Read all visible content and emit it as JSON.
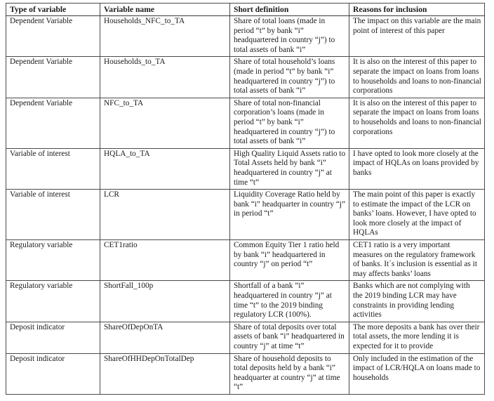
{
  "table": {
    "headers": [
      "Type of variable",
      "Variable  name",
      "Short definition",
      "Reasons for inclusion"
    ],
    "rows": [
      {
        "type": "Dependent Variable",
        "name": "Households_NFC_to_TA",
        "definition": "Share of total loans (made in period “t” by bank “i” headquartered in country “j”) to total assets of bank “i”",
        "reason": "The impact on this variable are the main point of interest of this paper"
      },
      {
        "type": "Dependent Variable",
        "name": "Households_to_TA",
        "definition": "Share of total household’s loans (made in period “t” by bank “i” headquartered in country “j”) to total assets of bank “i”",
        "reason": "It is also on the interest of this paper to separate the impact on loans from loans to households and loans to non-financial corporations"
      },
      {
        "type": "Dependent Variable",
        "name": "NFC_to_TA",
        "definition": "Share of total non-financial corporation’s loans (made in period “t” by bank “i” headquartered in country “j”) to total assets of bank “i”",
        "reason": "It is also on the interest of this paper to separate the impact on loans from loans to households and loans to non-financial corporations"
      },
      {
        "type": "Variable of interest",
        "name": "HQLA_to_TA",
        "definition": "High Quality Liquid Assets ratio to Total Assets held by bank “i” headquartered in country “j” at time “t”",
        "reason": "I have opted to look more closely at the impact of HQLAs on loans provided by banks"
      },
      {
        "type": "Variable of interest",
        "name": "LCR",
        "definition": "Liquidity Coverage Ratio held by bank “i” headquarter in country “j” in period “t”",
        "reason": "The main point of this paper is exactly to estimate the impact of the LCR on banks’ loans. However, I have opted to look more closely at the impact of HQLAs"
      },
      {
        "type": "Regulatory variable",
        "name": "CET1ratio",
        "definition": "Common Equity Tier 1 ratio held by bank “i” headquartered in country “j” on period “t”",
        "reason": "CET1 ratio is a very important measures on the regulatory framework of banks. It´s inclusion is essential as it may affects banks’ loans"
      },
      {
        "type": "Regulatory variable",
        "name": "ShortFall_100p",
        "definition": "Shortfall of a bank ”i” headquartered in country “j” at time “t” to the 2019 binding regulatory LCR (100%).",
        "reason": "Banks which are not complying with the 2019 binding LCR may have constraints in providing lending activities"
      },
      {
        "type": "Deposit indicator",
        "name": "ShareOfDepOnTA",
        "definition": "Share of total deposits over total assets of bank “i” headquartered in country “j” at time “t”",
        "reason": "The more deposits a bank has over their total assets, the more lending it is expected for it to provide"
      },
      {
        "type": "Deposit indicator",
        "name": "ShareOfHHDepOnTotalDep",
        "definition": "Share of household deposits to total deposits held by a bank “i” headquarter at country “j” at time “t”",
        "reason": "Only included in the estimation of the impact of LCR/HQLA on loans made to households"
      }
    ]
  }
}
